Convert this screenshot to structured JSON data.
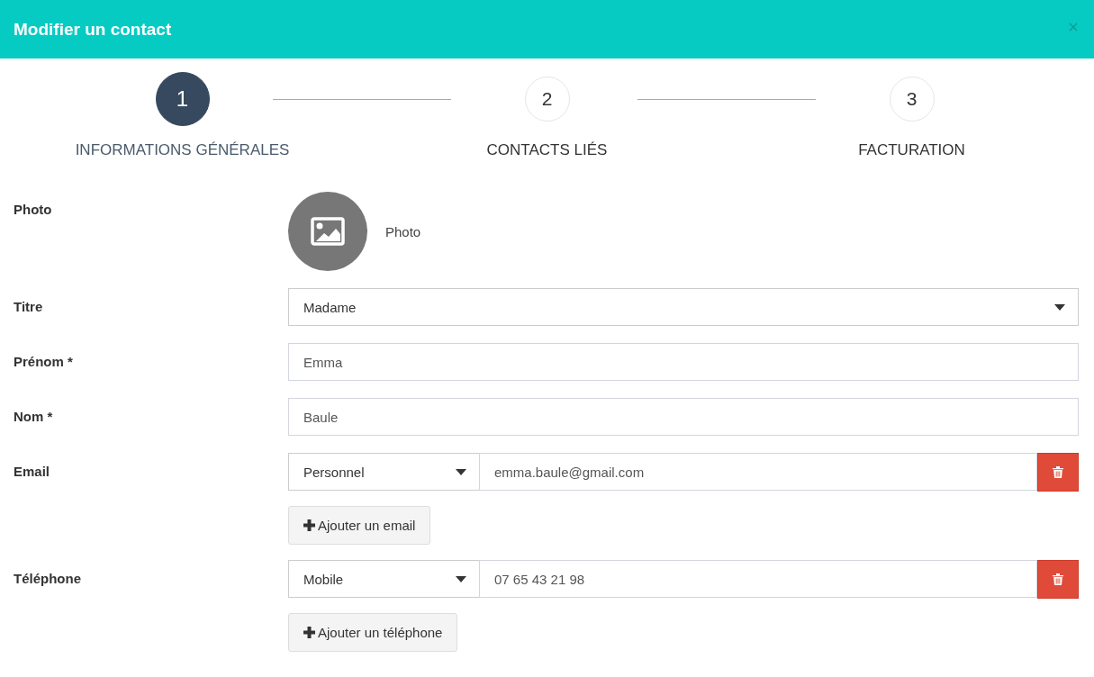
{
  "dialog": {
    "title": "Modifier un contact"
  },
  "steps": [
    {
      "number": "1",
      "label": "INFORMATIONS GÉNÉRALES",
      "selected": true
    },
    {
      "number": "2",
      "label": "CONTACTS LIÉS",
      "selected": false
    },
    {
      "number": "3",
      "label": "FACTURATION",
      "selected": false
    }
  ],
  "form": {
    "fields": [
      {
        "kind": "photo",
        "label": "Photo",
        "caption": "Photo"
      },
      {
        "kind": "select",
        "label": "Titre",
        "value": "Madame"
      },
      {
        "kind": "text",
        "label": "Prénom *",
        "value": "Emma"
      },
      {
        "kind": "text",
        "label": "Nom *",
        "value": "Baule"
      },
      {
        "kind": "multi",
        "label": "Email",
        "entries": [
          {
            "type": "Personnel",
            "value": "emma.baule@gmail.com"
          }
        ],
        "add_button": "Ajouter un email"
      },
      {
        "kind": "multi",
        "label": "Téléphone",
        "entries": [
          {
            "type": "Mobile",
            "value": "07 65 43 21 98"
          }
        ],
        "add_button": "Ajouter un téléphone"
      }
    ]
  }
}
